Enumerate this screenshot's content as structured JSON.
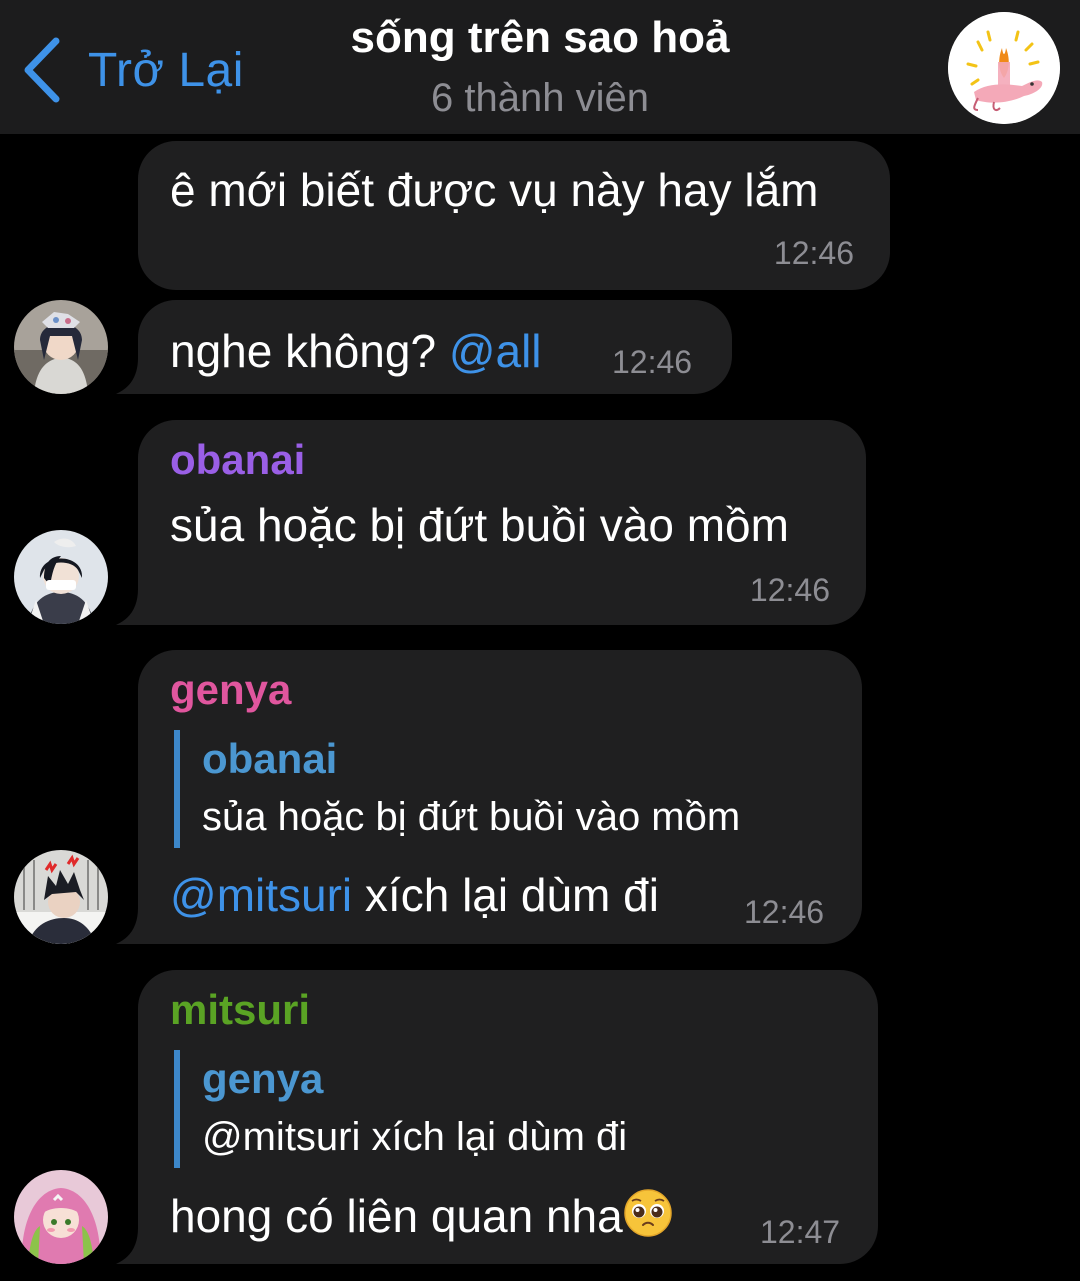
{
  "header": {
    "back_label": "Trở Lại",
    "title": "sống trên sao hoả",
    "subtitle": "6 thành viên"
  },
  "messages": [
    {
      "text": "ê mới biết được vụ này hay lắm",
      "time": "12:46"
    },
    {
      "text": "nghe không?",
      "mention": "@all",
      "time": "12:46"
    },
    {
      "sender": "obanai",
      "sender_color": "#9a5fe6",
      "text": "sủa hoặc bị đứt buồi vào mồm",
      "time": "12:46"
    },
    {
      "sender": "genya",
      "sender_color": "#e0569e",
      "reply_name": "obanai",
      "reply_text": "sủa hoặc bị đứt buồi vào mồm",
      "mention": "@mitsuri",
      "text": "xích lại dùm đi",
      "time": "12:46"
    },
    {
      "sender": "mitsuri",
      "sender_color": "#5aa324",
      "reply_name": "genya",
      "reply_text": "@mitsuri xích lại dùm đi",
      "text": "hong có liên quan nha",
      "emoji": "pleading-face",
      "time": "12:47"
    }
  ],
  "colors": {
    "accent": "#3e92e8",
    "bubble": "#1f1f20",
    "header": "#1c1c1d",
    "time": "#8d8d93"
  }
}
